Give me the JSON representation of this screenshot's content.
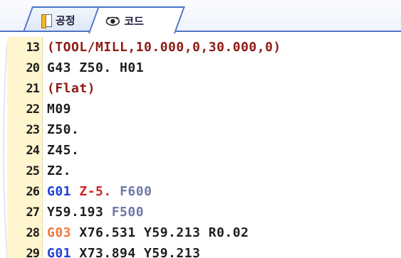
{
  "tabs": [
    {
      "label": "공정",
      "icon": "document-icon",
      "active": false
    },
    {
      "label": "코드",
      "icon": "eye-icon",
      "active": true
    }
  ],
  "editor": {
    "lines": [
      {
        "number": "13",
        "tokens": [
          {
            "text": "(TOOL/MILL,10.000,0,30.000,0)",
            "kind": "comment"
          }
        ]
      },
      {
        "number": "20",
        "tokens": [
          {
            "text": "G43 Z50. H01",
            "kind": "plain"
          }
        ]
      },
      {
        "number": "21",
        "tokens": [
          {
            "text": "(Flat)",
            "kind": "comment"
          }
        ]
      },
      {
        "number": "22",
        "tokens": [
          {
            "text": "M09",
            "kind": "plain"
          }
        ]
      },
      {
        "number": "23",
        "tokens": [
          {
            "text": "Z50.",
            "kind": "plain"
          }
        ]
      },
      {
        "number": "24",
        "tokens": [
          {
            "text": "Z45.",
            "kind": "plain"
          }
        ]
      },
      {
        "number": "25",
        "tokens": [
          {
            "text": "Z2.",
            "kind": "plain"
          }
        ]
      },
      {
        "number": "26",
        "tokens": [
          {
            "text": "G01",
            "kind": "g01"
          },
          {
            "text": " ",
            "kind": "plain"
          },
          {
            "text": "Z-5.",
            "kind": "z"
          },
          {
            "text": " ",
            "kind": "plain"
          },
          {
            "text": "F600",
            "kind": "f"
          }
        ]
      },
      {
        "number": "27",
        "tokens": [
          {
            "text": "Y59.193",
            "kind": "plain"
          },
          {
            "text": " ",
            "kind": "plain"
          },
          {
            "text": "F500",
            "kind": "f"
          }
        ]
      },
      {
        "number": "28",
        "tokens": [
          {
            "text": "G03",
            "kind": "g03"
          },
          {
            "text": " X76.531 Y59.213 R0.02",
            "kind": "plain"
          }
        ]
      },
      {
        "number": "29",
        "tokens": [
          {
            "text": "G01",
            "kind": "g01"
          },
          {
            "text": " X73.894 Y59.213",
            "kind": "plain"
          }
        ]
      }
    ]
  },
  "colors": {
    "gutter_bg": "#fff6cf",
    "comment": "#8e1b14",
    "g01": "#1d3fd4",
    "z_move": "#d62424",
    "feed": "#6f78a8",
    "g03": "#ef7a3c",
    "tab_border": "#4d74c2"
  }
}
